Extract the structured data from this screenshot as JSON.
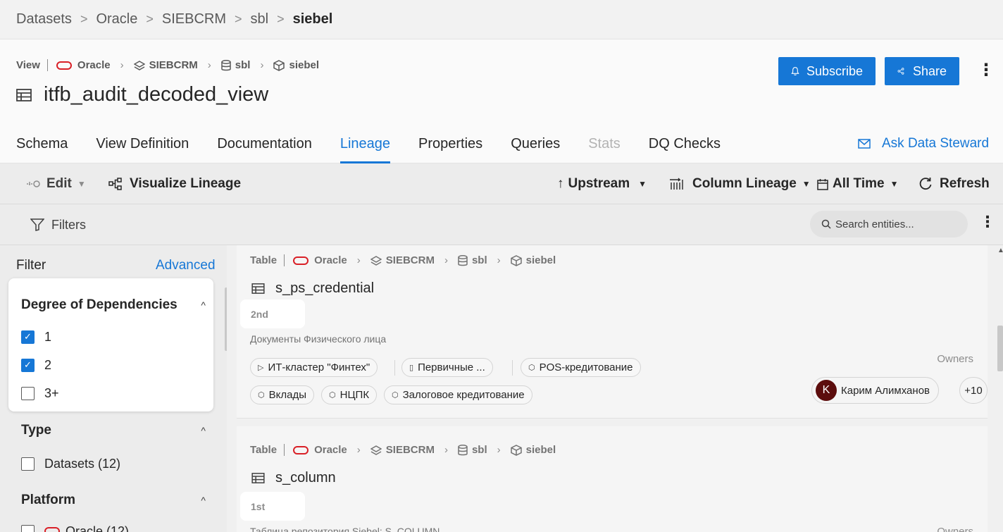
{
  "breadcrumb": [
    "Datasets",
    "Oracle",
    "SIEBCRM",
    "sbl",
    "siebel"
  ],
  "header": {
    "entity_type": "View",
    "path": {
      "platform": "Oracle",
      "db": "SIEBCRM",
      "schema": "sbl",
      "container": "siebel"
    },
    "title": "itfb_audit_decoded_view",
    "subscribe_label": "Subscribe",
    "share_label": "Share"
  },
  "tabs": [
    "Schema",
    "View Definition",
    "Documentation",
    "Lineage",
    "Properties",
    "Queries",
    "Stats",
    "DQ Checks"
  ],
  "active_tab": "Lineage",
  "disabled_tab": "Stats",
  "ask_steward_label": "Ask Data Steward",
  "toolbar": {
    "edit_label": "Edit",
    "visualize_label": "Visualize Lineage",
    "direction_label": "Upstream",
    "column_lineage_label": "Column Lineage",
    "time_label": "All Time",
    "refresh_label": "Refresh"
  },
  "filterbar": {
    "filters_label": "Filters",
    "search_placeholder": "Search entities..."
  },
  "sidebar": {
    "filter_label": "Filter",
    "advanced_label": "Advanced",
    "degree": {
      "title": "Degree of Dependencies",
      "options": [
        {
          "label": "1",
          "checked": true
        },
        {
          "label": "2",
          "checked": true
        },
        {
          "label": "3+",
          "checked": false
        }
      ]
    },
    "type": {
      "title": "Type",
      "options": [
        {
          "label": "Datasets (12)",
          "checked": false
        }
      ]
    },
    "platform": {
      "title": "Platform",
      "options": [
        {
          "label": "Oracle (12)",
          "checked": false
        }
      ]
    }
  },
  "results": [
    {
      "entity_type": "Table",
      "path": {
        "platform": "Oracle",
        "db": "SIEBCRM",
        "schema": "sbl",
        "container": "siebel"
      },
      "name": "s_ps_credential",
      "degree": "2nd",
      "description": "Документы Физического лица",
      "owners_label": "Owners",
      "tags_row1": [
        "ИТ-кластер \"Финтех\"",
        "Первичные ...",
        "POS-кредитование"
      ],
      "tags_row2": [
        "Вклады",
        "НЦПК",
        "Залоговое кредитование"
      ],
      "owner": {
        "initial": "K",
        "name": "Карим Алимханов"
      },
      "more_owners": "+10"
    },
    {
      "entity_type": "Table",
      "path": {
        "platform": "Oracle",
        "db": "SIEBCRM",
        "schema": "sbl",
        "container": "siebel"
      },
      "name": "s_column",
      "degree": "1st",
      "description": "Таблица репозитория Siebel: S_COLUMN",
      "owners_label": "Owners"
    }
  ]
}
